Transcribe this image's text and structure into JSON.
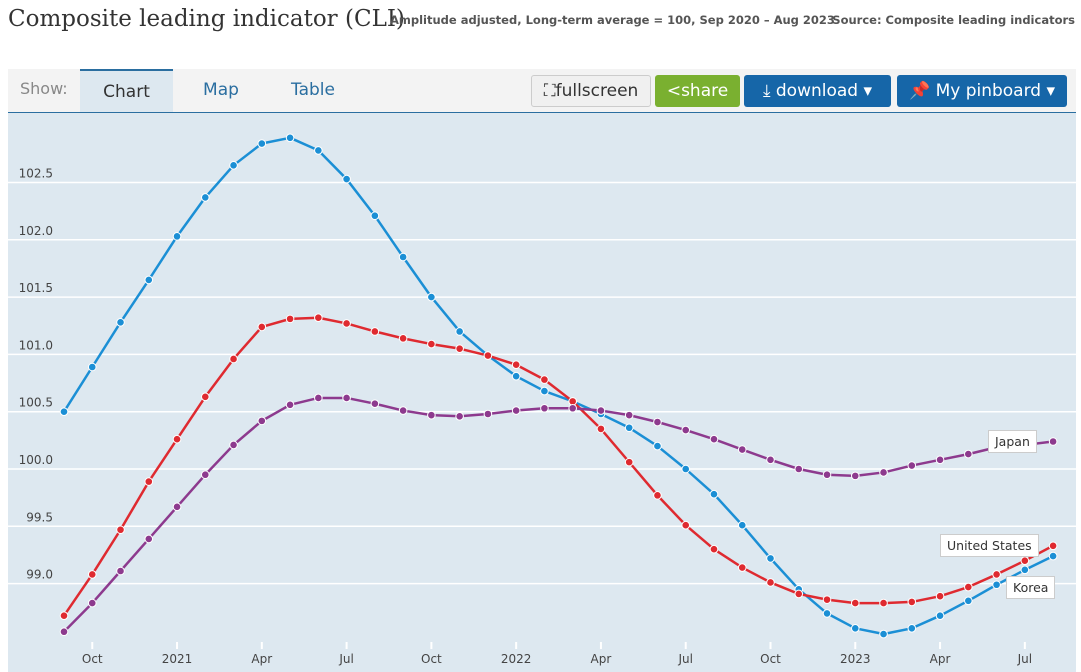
{
  "header": {
    "title": "Composite leading indicator (CLI)",
    "subtitle": "Amplitude adjusted, Long-term average = 100, Sep 2020 – Aug 2023",
    "source": "Source: Composite leading indicators"
  },
  "toolbar": {
    "show_label": "Show:",
    "tabs": [
      "Chart",
      "Map",
      "Table"
    ],
    "active_tab": "Chart",
    "fullscreen": "fullscreen",
    "share": "share",
    "download": "download ▾",
    "pinboard": "My pinboard ▾"
  },
  "colors": {
    "Korea": "#1b8fd5",
    "United States": "#df2a30",
    "Japan": "#8d3a8e",
    "background": "#dde8f0"
  },
  "chart_data": {
    "type": "line",
    "x_start": "2020-09",
    "x_end": "2023-08",
    "xticks": [
      {
        "month": "2020-10",
        "label": "Oct"
      },
      {
        "month": "2021-01",
        "label": "2021"
      },
      {
        "month": "2021-04",
        "label": "Apr"
      },
      {
        "month": "2021-07",
        "label": "Jul"
      },
      {
        "month": "2021-10",
        "label": "Oct"
      },
      {
        "month": "2022-01",
        "label": "2022"
      },
      {
        "month": "2022-04",
        "label": "Apr"
      },
      {
        "month": "2022-07",
        "label": "Jul"
      },
      {
        "month": "2022-10",
        "label": "Oct"
      },
      {
        "month": "2023-01",
        "label": "2023"
      },
      {
        "month": "2023-04",
        "label": "Apr"
      },
      {
        "month": "2023-07",
        "label": "Jul"
      }
    ],
    "yticks": [
      "99.0",
      "99.5",
      "100.0",
      "100.5",
      "101.0",
      "101.5",
      "102.0",
      "102.5"
    ],
    "ylim": [
      98.5,
      103.0
    ],
    "grid": true,
    "series": [
      {
        "name": "Korea",
        "values": [
          100.5,
          100.89,
          101.28,
          101.65,
          102.03,
          102.37,
          102.65,
          102.84,
          102.89,
          102.78,
          102.53,
          102.21,
          101.85,
          101.5,
          101.2,
          100.99,
          100.81,
          100.68,
          100.59,
          100.48,
          100.36,
          100.2,
          100.0,
          99.78,
          99.51,
          99.22,
          98.95,
          98.74,
          98.61,
          98.56,
          98.61,
          98.72,
          98.85,
          98.99,
          99.12,
          99.24
        ]
      },
      {
        "name": "United States",
        "values": [
          98.72,
          99.08,
          99.47,
          99.89,
          100.26,
          100.63,
          100.96,
          101.24,
          101.31,
          101.32,
          101.27,
          101.2,
          101.14,
          101.09,
          101.05,
          100.99,
          100.91,
          100.78,
          100.59,
          100.35,
          100.06,
          99.77,
          99.51,
          99.3,
          99.14,
          99.01,
          98.91,
          98.86,
          98.83,
          98.83,
          98.84,
          98.89,
          98.97,
          99.08,
          99.2,
          99.33
        ]
      },
      {
        "name": "Japan",
        "values": [
          98.58,
          98.83,
          99.11,
          99.39,
          99.67,
          99.95,
          100.21,
          100.42,
          100.56,
          100.62,
          100.62,
          100.57,
          100.51,
          100.47,
          100.46,
          100.48,
          100.51,
          100.53,
          100.53,
          100.51,
          100.47,
          100.41,
          100.34,
          100.26,
          100.17,
          100.08,
          100.0,
          99.95,
          99.94,
          99.97,
          100.03,
          100.08,
          100.13,
          100.19,
          100.21,
          100.24
        ]
      }
    ]
  }
}
